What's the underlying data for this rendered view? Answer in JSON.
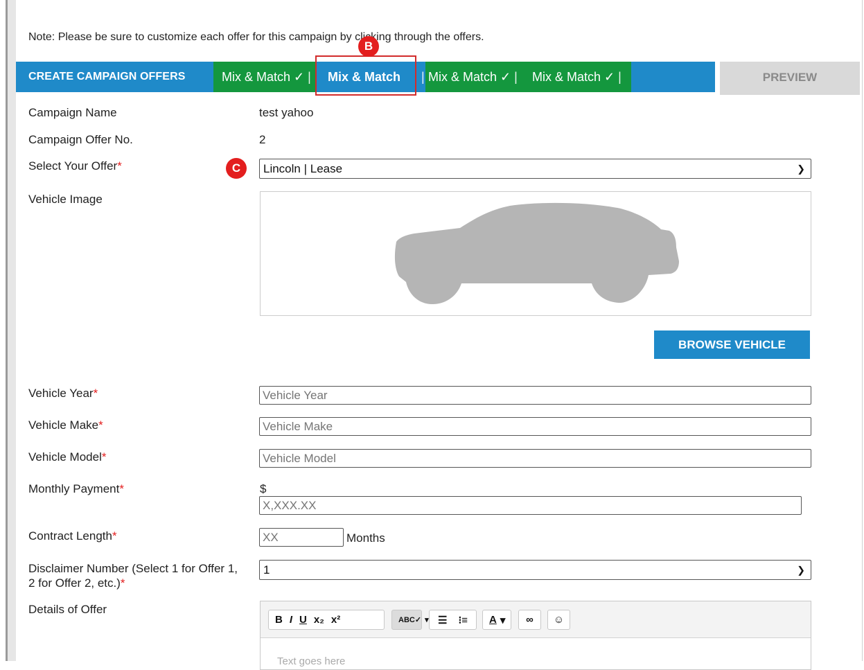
{
  "note": "Note: Please be sure to customize each offer for this campaign by clicking through the offers.",
  "tabbar": {
    "title": "CREATE CAMPAIGN OFFERS",
    "tabs": [
      {
        "label": "Mix & Match ✓",
        "active": false
      },
      {
        "label": "Mix & Match",
        "active": true
      },
      {
        "label": "Mix & Match ✓",
        "active": false
      },
      {
        "label": "Mix & Match ✓",
        "active": false
      }
    ],
    "separator": "|",
    "preview_label": "PREVIEW",
    "colors": {
      "bar": "#1f8ac9",
      "tab": "#14973e",
      "preview": "#d9d9d9"
    }
  },
  "badges": {
    "b": "B",
    "c": "C"
  },
  "form": {
    "campaign_name_label": "Campaign Name",
    "campaign_name_value": "test yahoo",
    "offer_no_label": "Campaign Offer No.",
    "offer_no_value": "2",
    "select_offer_label": "Select Your Offer",
    "select_offer_value": "Lincoln | Lease",
    "vehicle_image_label": "Vehicle Image",
    "browse_vehicle_label": "BROWSE VEHICLE",
    "year_label": "Vehicle Year",
    "year_placeholder": "Vehicle Year",
    "make_label": "Vehicle Make",
    "make_placeholder": "Vehicle Make",
    "model_label": "Vehicle Model",
    "model_placeholder": "Vehicle Model",
    "payment_label": "Monthly Payment",
    "currency": "$",
    "payment_placeholder": "X,XXX.XX",
    "contract_label": "Contract Length",
    "contract_placeholder": "XX",
    "contract_unit": "Months",
    "disclaimer_label_line1": "Disclaimer Number (Select 1 for Offer 1,",
    "disclaimer_label_line2": "2 for Offer 2, etc.)",
    "disclaimer_value": "1",
    "details_label": "Details of Offer",
    "required_marker": "*"
  },
  "editor": {
    "toolbar": {
      "bold": "B",
      "italic": "I",
      "underline": "U",
      "subscript": "x₂",
      "superscript": "x²",
      "spellcheck": "ABC✓",
      "font_color": "A"
    },
    "placeholder": "Text goes here"
  }
}
